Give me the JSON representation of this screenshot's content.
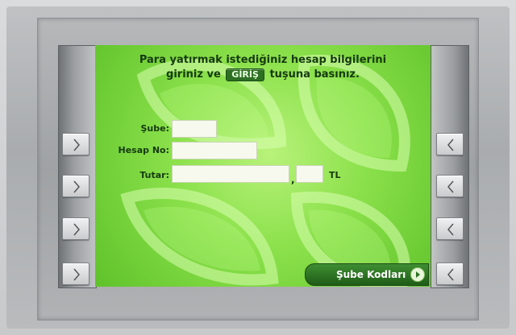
{
  "screen": {
    "instruction_line1": "Para yatırmak istediğiniz hesap bilgilerini",
    "instruction_pre": "giriniz ve",
    "giris_badge": "GİRİŞ",
    "instruction_post": "tuşuna basınız."
  },
  "form": {
    "sube_label": "Şube:",
    "sube_value": "",
    "hesap_label": "Hesap No:",
    "hesap_value": "",
    "tutar_label": "Tutar:",
    "tutar_whole_value": "",
    "tutar_decimal_value": "",
    "decimal_separator": ",",
    "currency": "TL"
  },
  "actions": {
    "sube_kodlari_label": "Şube Kodları"
  },
  "icons": {
    "left_buttons": [
      "chevron-right-icon",
      "chevron-right-icon",
      "chevron-right-icon",
      "chevron-right-icon"
    ],
    "right_buttons": [
      "chevron-left-icon",
      "chevron-left-icon",
      "chevron-left-icon",
      "chevron-left-icon"
    ],
    "sube_arrow": "play-arrow-icon"
  },
  "colors": {
    "screen_green": "#8ae04a",
    "button_dark_green": "#1f5c17",
    "text_dark_green": "#163a10"
  }
}
